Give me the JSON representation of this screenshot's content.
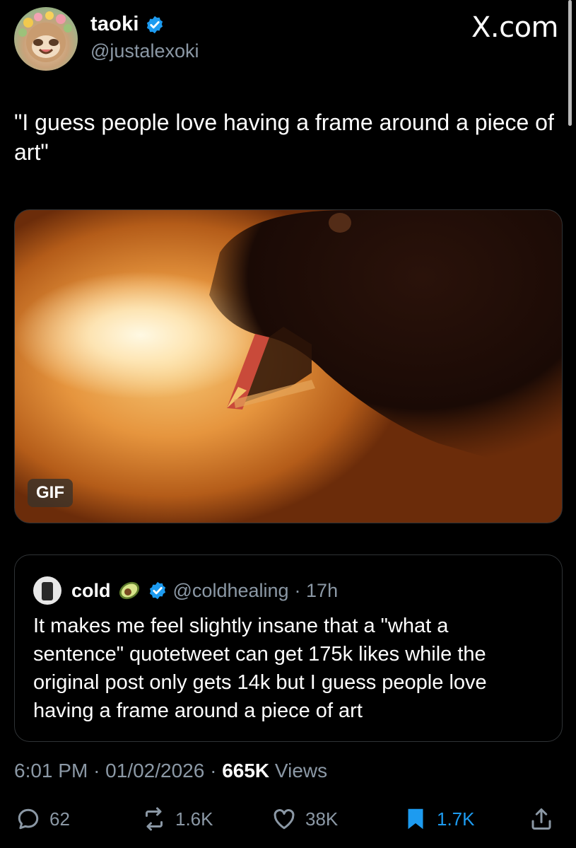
{
  "author": {
    "display_name": "taoki",
    "handle": "@justalexoki",
    "avatar": "avatar-icon",
    "verified": true
  },
  "brand": "X.com",
  "tweet": {
    "text": "\"I guess people love having a frame around a piece of art\""
  },
  "media": {
    "badge": "GIF"
  },
  "quoted": {
    "display_name": "cold",
    "emoji": "avocado-icon",
    "handle": "@coldhealing",
    "time": "· 17h",
    "text": "It makes me feel slightly insane that a \"what a sentence\" quotetweet can get 175k likes while the original post only gets 14k but I guess people love having a frame around a piece of art"
  },
  "meta": {
    "time": "6:01 PM",
    "date": "01/02/2026",
    "views_count": "665K",
    "views_label": "Views"
  },
  "actions": {
    "replies": "62",
    "reposts": "1.6K",
    "likes": "38K",
    "bookmarks": "1.7K"
  },
  "colors": {
    "background": "#000000",
    "text": "#ffffff",
    "secondary": "#8b98a5",
    "verified": "#1d9bf0",
    "border": "#2f3336"
  }
}
